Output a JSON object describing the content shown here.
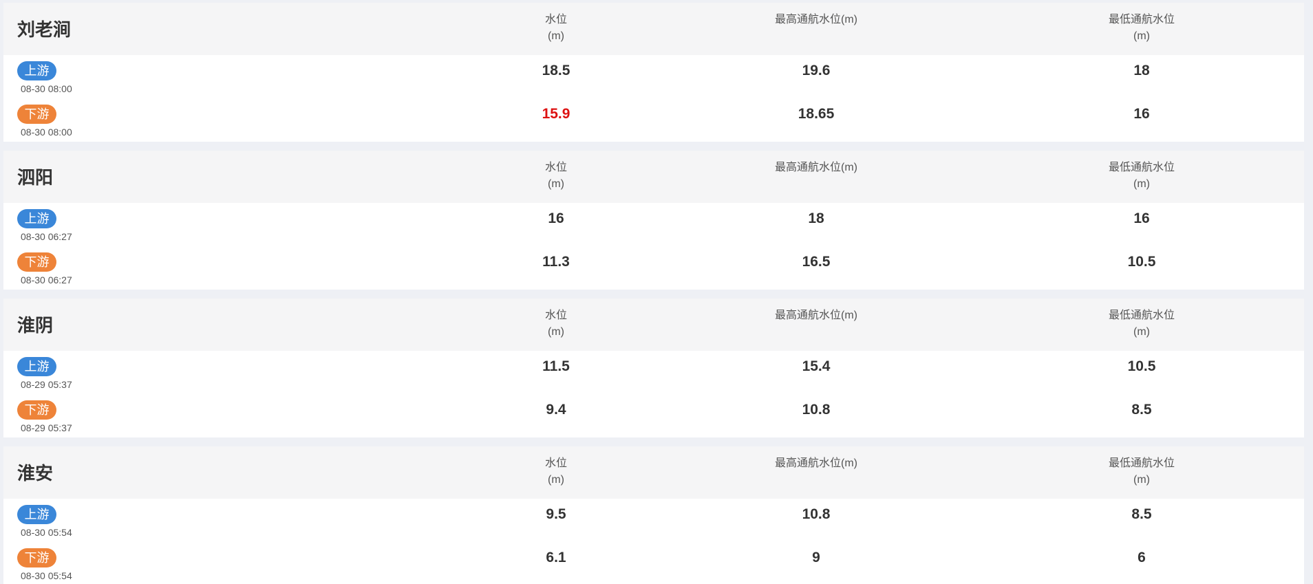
{
  "column_headers": {
    "water_level": "水位",
    "water_level_unit": "(m)",
    "max_nav": "最高通航水位(m)",
    "min_nav": "最低通航水位",
    "min_nav_unit": "(m)"
  },
  "labels": {
    "upstream": "上游",
    "downstream": "下游"
  },
  "colors": {
    "upstream_badge": "#3a87d9",
    "downstream_badge": "#ee8339",
    "alert_value": "#dd1111"
  },
  "stations": [
    {
      "name": "刘老涧",
      "upstream": {
        "time": "08-30 08:00",
        "level": "18.5",
        "max": "19.6",
        "min": "18",
        "alert": false
      },
      "downstream": {
        "time": "08-30 08:00",
        "level": "15.9",
        "max": "18.65",
        "min": "16",
        "alert": true
      }
    },
    {
      "name": "泗阳",
      "upstream": {
        "time": "08-30 06:27",
        "level": "16",
        "max": "18",
        "min": "16",
        "alert": false
      },
      "downstream": {
        "time": "08-30 06:27",
        "level": "11.3",
        "max": "16.5",
        "min": "10.5",
        "alert": false
      }
    },
    {
      "name": "淮阴",
      "upstream": {
        "time": "08-29 05:37",
        "level": "11.5",
        "max": "15.4",
        "min": "10.5",
        "alert": false
      },
      "downstream": {
        "time": "08-29 05:37",
        "level": "9.4",
        "max": "10.8",
        "min": "8.5",
        "alert": false
      }
    },
    {
      "name": "淮安",
      "upstream": {
        "time": "08-30 05:54",
        "level": "9.5",
        "max": "10.8",
        "min": "8.5",
        "alert": false
      },
      "downstream": {
        "time": "08-30 05:54",
        "level": "6.1",
        "max": "9",
        "min": "6",
        "alert": false
      }
    }
  ]
}
